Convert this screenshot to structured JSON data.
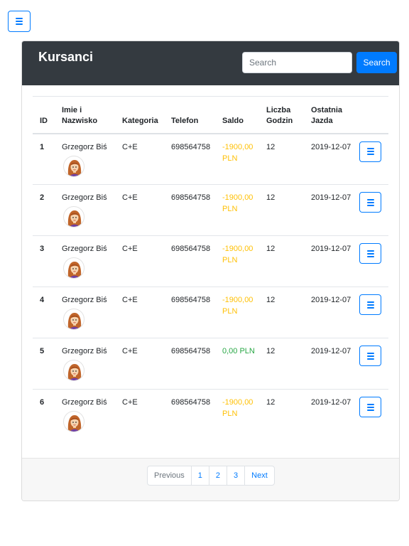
{
  "header": {
    "title": "Kursanci",
    "search_placeholder": "Search",
    "search_button": "Search"
  },
  "table": {
    "columns": [
      "ID",
      "Imie i Nazwisko",
      "Kategoria",
      "Telefon",
      "Saldo",
      "Liczba Godzin",
      "Ostatnia Jazda"
    ],
    "rows": [
      {
        "id": "1",
        "name": "Grzegorz Biś",
        "category": "C+E",
        "phone": "698564758",
        "saldo": "-1900,00 PLN",
        "saldo_status": "negative",
        "hours": "12",
        "last": "2019-12-07"
      },
      {
        "id": "2",
        "name": "Grzegorz Biś",
        "category": "C+E",
        "phone": "698564758",
        "saldo": "-1900,00 PLN",
        "saldo_status": "negative",
        "hours": "12",
        "last": "2019-12-07"
      },
      {
        "id": "3",
        "name": "Grzegorz Biś",
        "category": "C+E",
        "phone": "698564758",
        "saldo": "-1900,00 PLN",
        "saldo_status": "negative",
        "hours": "12",
        "last": "2019-12-07"
      },
      {
        "id": "4",
        "name": "Grzegorz Biś",
        "category": "C+E",
        "phone": "698564758",
        "saldo": "-1900,00 PLN",
        "saldo_status": "negative",
        "hours": "12",
        "last": "2019-12-07"
      },
      {
        "id": "5",
        "name": "Grzegorz Biś",
        "category": "C+E",
        "phone": "698564758",
        "saldo": "0,00 PLN",
        "saldo_status": "positive",
        "hours": "12",
        "last": "2019-12-07"
      },
      {
        "id": "6",
        "name": "Grzegorz Biś",
        "category": "C+E",
        "phone": "698564758",
        "saldo": "-1900,00 PLN",
        "saldo_status": "negative",
        "hours": "12",
        "last": "2019-12-07"
      }
    ]
  },
  "pagination": {
    "previous": "Previous",
    "pages": [
      "1",
      "2",
      "3"
    ],
    "next": "Next"
  },
  "colors": {
    "header_bg": "#343a40",
    "primary": "#007bff",
    "saldo_negative": "#ffc107",
    "saldo_positive": "#28a745"
  },
  "icons": {
    "menu": "hamburger-icon",
    "row_action": "hamburger-icon",
    "avatar": "avatar-woman"
  }
}
